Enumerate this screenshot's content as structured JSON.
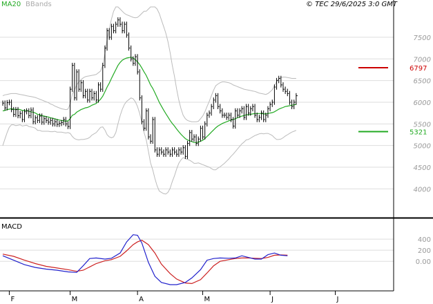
{
  "chart_data": [
    {
      "type": "line",
      "panel": "price",
      "legend": [
        "MA20",
        "BBands"
      ],
      "watermark": "© TEC 29/6/2025 3:0 GMT",
      "x_labels": [
        {
          "label": "F",
          "day": 3
        },
        {
          "label": "M",
          "day": 31
        },
        {
          "label": "A",
          "day": 62
        },
        {
          "label": "M",
          "day": 92
        },
        {
          "label": "J",
          "day": 123
        },
        {
          "label": "J",
          "day": 153
        }
      ],
      "y_ticks": [
        4000,
        4500,
        5000,
        5500,
        6000,
        6500,
        7000,
        7500
      ],
      "ylim": [
        3400,
        8200
      ],
      "xlim": [
        0,
        163
      ],
      "grid": true,
      "colors": {
        "price": "#000000",
        "ma20": "#22aa22",
        "bbands": "#bbbbbb",
        "resistance": "#cc0000",
        "support": "#22aa22"
      },
      "levels": [
        {
          "name": "resistance",
          "value": 6797,
          "label": "6797"
        },
        {
          "name": "support",
          "value": 5321,
          "label": "5321"
        }
      ],
      "close": [
        5980,
        5870,
        5990,
        6000,
        5830,
        5720,
        5830,
        5690,
        5740,
        5600,
        5780,
        5800,
        5690,
        5820,
        5550,
        5640,
        5580,
        5680,
        5540,
        5620,
        5580,
        5540,
        5580,
        5500,
        5550,
        5490,
        5510,
        5530,
        5600,
        5500,
        5440,
        6300,
        6850,
        6100,
        6700,
        6300,
        6450,
        6150,
        6250,
        6050,
        6250,
        6100,
        6200,
        6050,
        6400,
        6300,
        6850,
        7250,
        7650,
        7500,
        7750,
        7650,
        7800,
        7900,
        7800,
        7650,
        7800,
        7550,
        7250,
        7000,
        6900,
        7050,
        6700,
        6100,
        5550,
        5400,
        5800,
        5200,
        5100,
        5600,
        4900,
        4800,
        4900,
        4850,
        4800,
        4900,
        4850,
        4800,
        4900,
        4850,
        4800,
        4900,
        4850,
        4950,
        4750,
        5050,
        5300,
        5150,
        5200,
        5050,
        5150,
        5400,
        5200,
        5500,
        5700,
        5750,
        5900,
        6050,
        6150,
        5900,
        5800,
        5700,
        5700,
        5650,
        5700,
        5600,
        5450,
        5800,
        5700,
        5800,
        5850,
        5650,
        5900,
        5750,
        5850,
        5900,
        5700,
        5600,
        5650,
        5750,
        5600,
        5700,
        5850,
        5950,
        6000,
        6350,
        6500,
        6550,
        6400,
        6300,
        6250,
        6200,
        6000,
        5900,
        6000,
        6150
      ],
      "ma20": [
        5800,
        5810,
        5830,
        5840,
        5850,
        5840,
        5830,
        5840,
        5830,
        5810,
        5810,
        5810,
        5790,
        5780,
        5770,
        5750,
        5720,
        5710,
        5690,
        5680,
        5670,
        5660,
        5640,
        5630,
        5620,
        5600,
        5590,
        5580,
        5570,
        5560,
        5570,
        5620,
        5700,
        5720,
        5770,
        5800,
        5830,
        5850,
        5870,
        5880,
        5900,
        5930,
        5950,
        5970,
        6020,
        6070,
        6140,
        6240,
        6350,
        6440,
        6550,
        6650,
        6750,
        6850,
        6920,
        6970,
        7000,
        7020,
        7030,
        7040,
        7020,
        6980,
        6930,
        6870,
        6790,
        6700,
        6620,
        6510,
        6400,
        6320,
        6220,
        6110,
        6000,
        5910,
        5820,
        5740,
        5660,
        5580,
        5510,
        5450,
        5380,
        5320,
        5260,
        5210,
        5160,
        5130,
        5110,
        5090,
        5070,
        5070,
        5080,
        5100,
        5120,
        5160,
        5210,
        5260,
        5310,
        5360,
        5410,
        5450,
        5480,
        5510,
        5530,
        5550,
        5570,
        5590,
        5600,
        5620,
        5640,
        5660,
        5680,
        5690,
        5710,
        5710,
        5720,
        5730,
        5740,
        5740,
        5740,
        5740,
        5730,
        5730,
        5740,
        5750,
        5760,
        5780,
        5810,
        5840,
        5860,
        5880,
        5900,
        5910,
        5920,
        5930,
        5940,
        5950
      ],
      "bb_upper": [
        6150,
        6170,
        6180,
        6190,
        6200,
        6200,
        6200,
        6190,
        6180,
        6170,
        6160,
        6150,
        6140,
        6130,
        6120,
        6110,
        6090,
        6070,
        6050,
        6030,
        6010,
        5990,
        5960,
        5940,
        5910,
        5890,
        5870,
        5850,
        5840,
        5830,
        5840,
        5960,
        6190,
        6280,
        6400,
        6470,
        6520,
        6560,
        6590,
        6600,
        6610,
        6620,
        6630,
        6640,
        6680,
        6720,
        6850,
        7120,
        7450,
        7680,
        7920,
        8100,
        8200,
        8200,
        8150,
        8100,
        8050,
        8020,
        8000,
        7980,
        7960,
        7950,
        7960,
        8000,
        8050,
        8100,
        8100,
        8150,
        8200,
        8200,
        8200,
        8150,
        8050,
        7900,
        7750,
        7600,
        7400,
        7150,
        6850,
        6600,
        6300,
        6050,
        5850,
        5700,
        5620,
        5580,
        5560,
        5550,
        5550,
        5550,
        5560,
        5620,
        5680,
        5780,
        5900,
        6020,
        6150,
        6280,
        6380,
        6420,
        6450,
        6470,
        6470,
        6460,
        6450,
        6430,
        6400,
        6380,
        6360,
        6340,
        6320,
        6300,
        6290,
        6280,
        6270,
        6260,
        6250,
        6230,
        6210,
        6200,
        6190,
        6180,
        6200,
        6240,
        6290,
        6380,
        6480,
        6540,
        6570,
        6580,
        6580,
        6570,
        6560,
        6550,
        6550,
        6550
      ],
      "bb_lower": [
        5000,
        5150,
        5300,
        5420,
        5480,
        5480,
        5460,
        5470,
        5480,
        5450,
        5460,
        5470,
        5440,
        5430,
        5420,
        5400,
        5350,
        5350,
        5330,
        5330,
        5330,
        5330,
        5320,
        5320,
        5330,
        5310,
        5310,
        5310,
        5300,
        5290,
        5300,
        5280,
        5210,
        5160,
        5140,
        5130,
        5140,
        5140,
        5150,
        5160,
        5190,
        5240,
        5270,
        5300,
        5360,
        5420,
        5430,
        5360,
        5250,
        5200,
        5180,
        5200,
        5300,
        5500,
        5690,
        5840,
        5950,
        6020,
        6060,
        6100,
        6080,
        6010,
        5900,
        5740,
        5530,
        5300,
        5140,
        4870,
        4600,
        4440,
        4240,
        4070,
        3950,
        3920,
        3890,
        3880,
        3920,
        4010,
        4170,
        4300,
        4460,
        4590,
        4670,
        4720,
        4700,
        4680,
        4660,
        4630,
        4590,
        4590,
        4600,
        4580,
        4560,
        4540,
        4520,
        4500,
        4470,
        4440,
        4440,
        4480,
        4510,
        4550,
        4590,
        4640,
        4690,
        4750,
        4800,
        4860,
        4920,
        4980,
        5040,
        5080,
        5130,
        5140,
        5170,
        5200,
        5230,
        5250,
        5270,
        5280,
        5270,
        5280,
        5280,
        5260,
        5230,
        5180,
        5140,
        5140,
        5150,
        5180,
        5220,
        5250,
        5280,
        5310,
        5330,
        5350
      ]
    },
    {
      "type": "line",
      "panel": "macd",
      "title": "MACD",
      "y_ticks": [
        0,
        200,
        400
      ],
      "y_tick_labels": [
        "0.00",
        "200",
        "400"
      ],
      "ylim": [
        -470,
        700
      ],
      "grid": true,
      "colors": {
        "macd": "#2020cc",
        "signal": "#cc2020"
      },
      "macd": [
        [
          0,
          100
        ],
        [
          5,
          20
        ],
        [
          10,
          -60
        ],
        [
          15,
          -110
        ],
        [
          20,
          -140
        ],
        [
          25,
          -160
        ],
        [
          30,
          -190
        ],
        [
          34,
          -200
        ],
        [
          37,
          -80
        ],
        [
          40,
          50
        ],
        [
          43,
          60
        ],
        [
          47,
          40
        ],
        [
          50,
          55
        ],
        [
          54,
          150
        ],
        [
          57,
          350
        ],
        [
          60,
          480
        ],
        [
          62,
          470
        ],
        [
          64,
          330
        ],
        [
          67,
          -20
        ],
        [
          70,
          -270
        ],
        [
          73,
          -380
        ],
        [
          77,
          -420
        ],
        [
          80,
          -420
        ],
        [
          84,
          -380
        ],
        [
          87,
          -300
        ],
        [
          91,
          -150
        ],
        [
          94,
          20
        ],
        [
          97,
          50
        ],
        [
          100,
          60
        ],
        [
          104,
          55
        ],
        [
          107,
          60
        ],
        [
          110,
          100
        ],
        [
          113,
          70
        ],
        [
          116,
          40
        ],
        [
          119,
          40
        ],
        [
          122,
          120
        ],
        [
          125,
          150
        ],
        [
          128,
          110
        ],
        [
          131,
          100
        ]
      ],
      "signal": [
        [
          0,
          130
        ],
        [
          5,
          90
        ],
        [
          10,
          20
        ],
        [
          15,
          -40
        ],
        [
          20,
          -90
        ],
        [
          25,
          -120
        ],
        [
          30,
          -150
        ],
        [
          34,
          -180
        ],
        [
          37,
          -160
        ],
        [
          40,
          -100
        ],
        [
          43,
          -40
        ],
        [
          47,
          10
        ],
        [
          50,
          30
        ],
        [
          54,
          90
        ],
        [
          57,
          190
        ],
        [
          60,
          300
        ],
        [
          62,
          350
        ],
        [
          64,
          380
        ],
        [
          67,
          300
        ],
        [
          70,
          150
        ],
        [
          73,
          -50
        ],
        [
          77,
          -220
        ],
        [
          80,
          -320
        ],
        [
          84,
          -390
        ],
        [
          87,
          -400
        ],
        [
          91,
          -330
        ],
        [
          94,
          -210
        ],
        [
          97,
          -80
        ],
        [
          100,
          0
        ],
        [
          104,
          30
        ],
        [
          107,
          50
        ],
        [
          110,
          60
        ],
        [
          113,
          60
        ],
        [
          116,
          55
        ],
        [
          119,
          50
        ],
        [
          122,
          70
        ],
        [
          125,
          110
        ],
        [
          128,
          115
        ],
        [
          131,
          110
        ]
      ]
    }
  ]
}
